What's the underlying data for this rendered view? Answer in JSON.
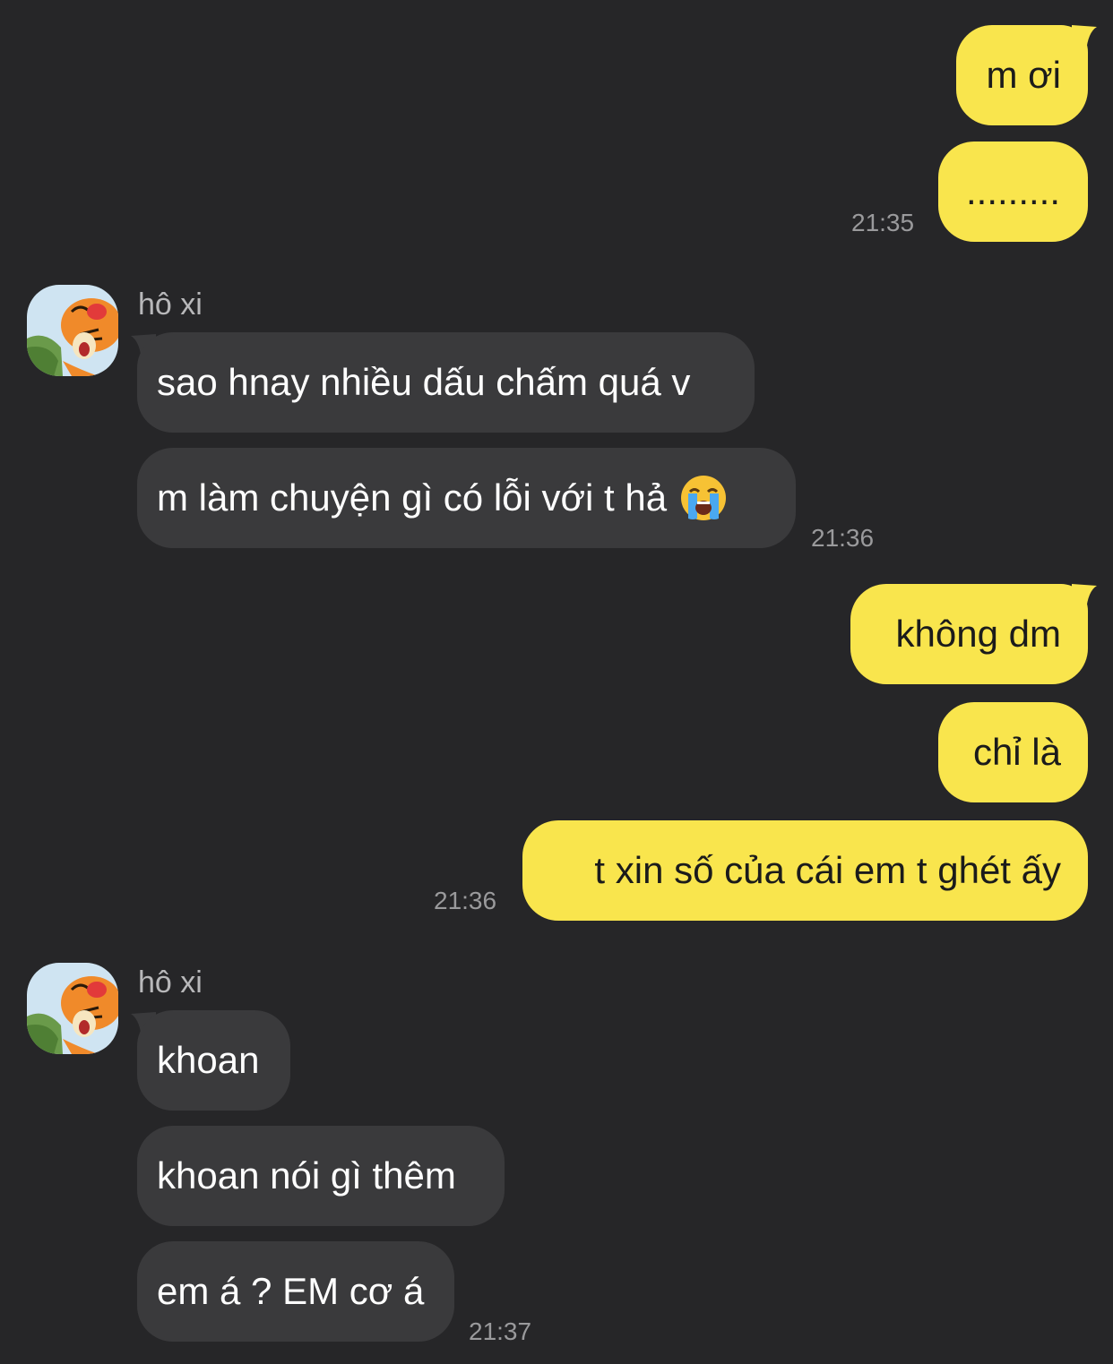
{
  "colors": {
    "background": "#262628",
    "outgoing_bubble": "#F9E54D",
    "incoming_bubble": "#3A3A3C",
    "timestamp": "#9a9a9c"
  },
  "conversation": [
    {
      "direction": "out",
      "text": "m ơi"
    },
    {
      "direction": "out",
      "text": ".........",
      "time": "21:35"
    },
    {
      "direction": "in",
      "sender": "hô xi",
      "avatar": "tigger-avatar"
    },
    {
      "direction": "in",
      "text": "sao hnay nhiều dấu chấm quá v"
    },
    {
      "direction": "in",
      "text": "m làm chuyện gì có lỗi với t hả",
      "emoji": "loudly-crying-face",
      "time": "21:36"
    },
    {
      "direction": "out",
      "text": "không dm"
    },
    {
      "direction": "out",
      "text": "chỉ là"
    },
    {
      "direction": "out",
      "text": "t xin số của cái em t ghét ấy",
      "time": "21:36"
    },
    {
      "direction": "in",
      "sender": "hô xi",
      "avatar": "tigger-avatar"
    },
    {
      "direction": "in",
      "text": "khoan"
    },
    {
      "direction": "in",
      "text": "khoan nói gì thêm"
    },
    {
      "direction": "in",
      "text": "em á ? EM cơ á",
      "time": "21:37"
    }
  ]
}
